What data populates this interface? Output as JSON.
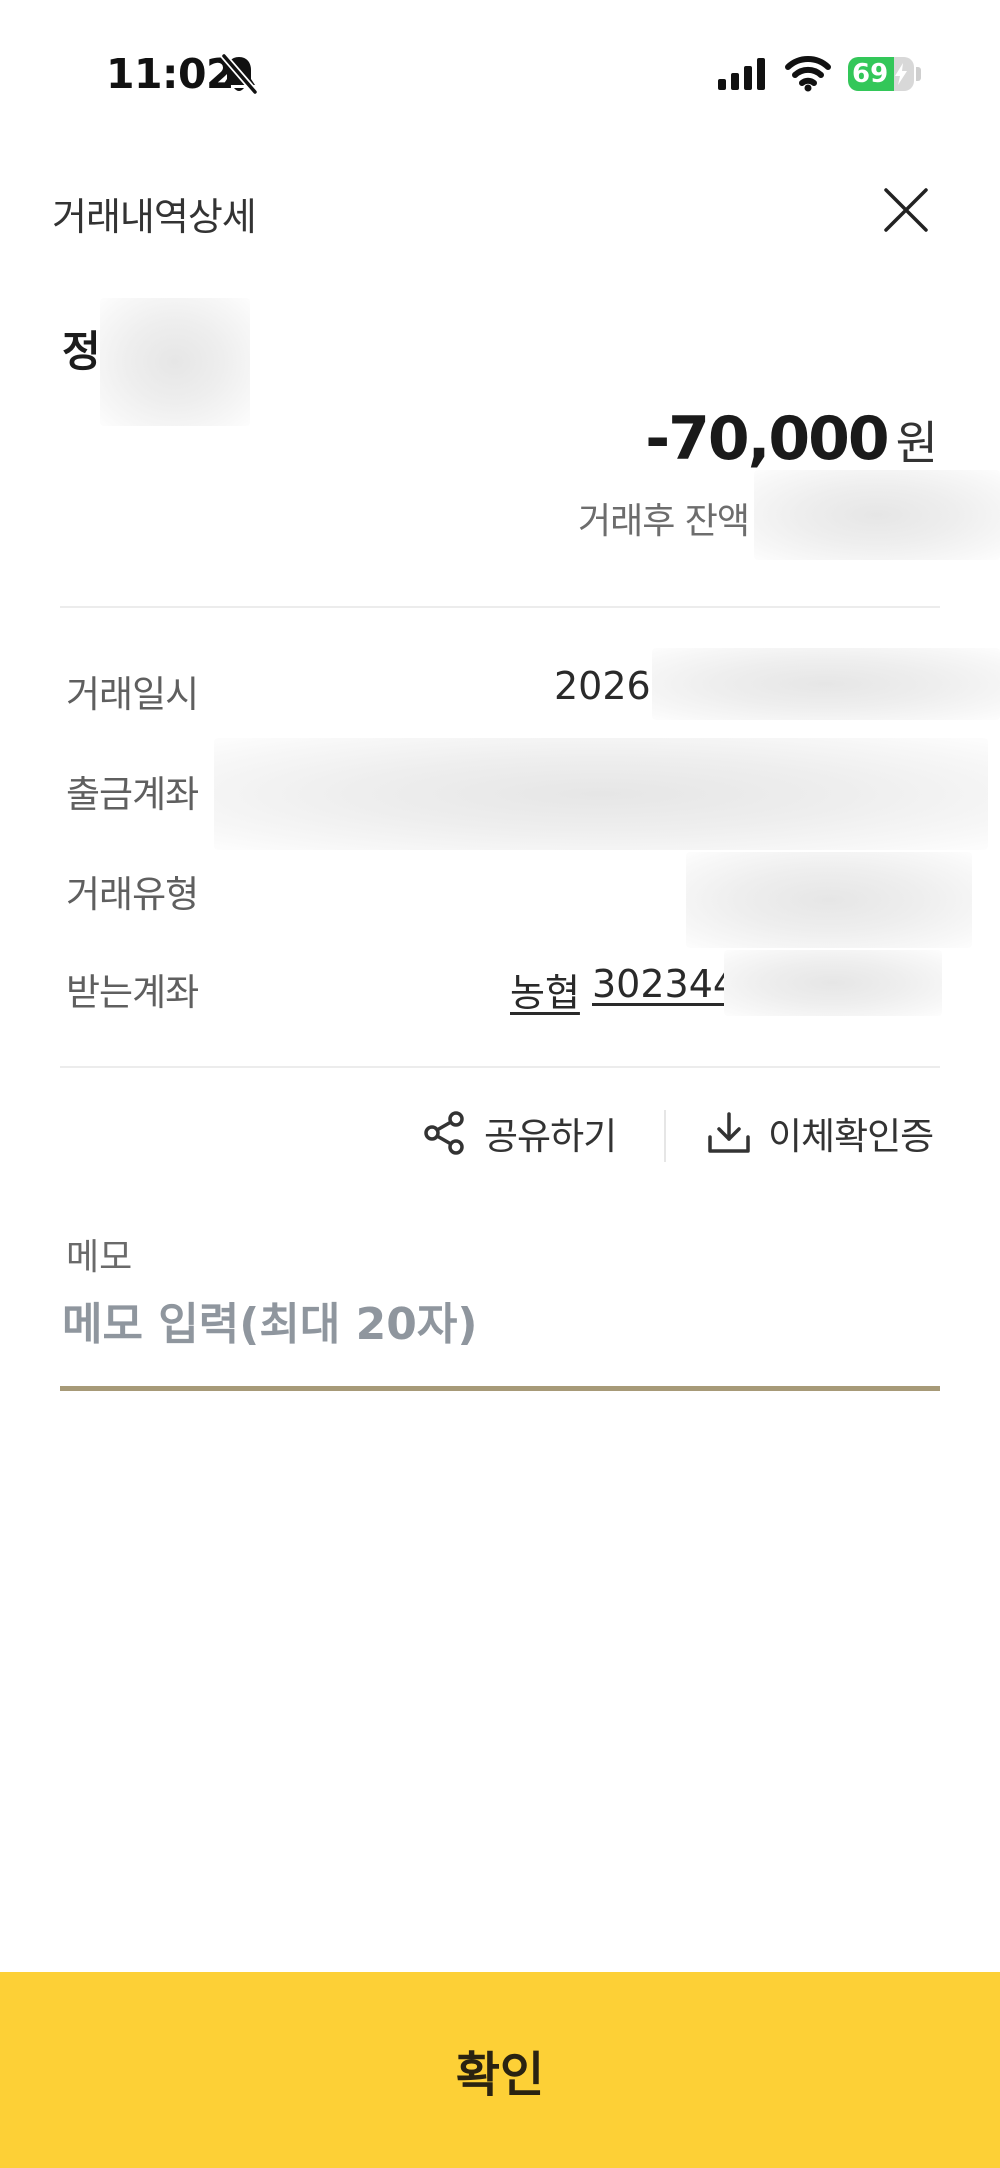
{
  "status_bar": {
    "time": "11:02",
    "battery_percent": "69",
    "battery_level": 0.69,
    "battery_color": "#33c759",
    "icons": [
      "bell-slash-icon",
      "cellular-signal-icon",
      "wifi-icon",
      "battery-icon"
    ]
  },
  "header": {
    "title": "거래내역상세",
    "close_icon": "close-icon"
  },
  "summary": {
    "recipient_name": "정",
    "amount": "-70,000",
    "amount_unit": "원",
    "balance_label": "거래후 잔액"
  },
  "details": {
    "datetime_label": "거래일시",
    "datetime_value": "2026",
    "from_account_label": "출금계좌",
    "type_label": "거래유형",
    "to_account_label": "받는계좌",
    "to_bank": "농협",
    "to_account": "302344"
  },
  "actions": {
    "share_label": "공유하기",
    "share_icon": "share-icon",
    "certificate_label": "이체확인증",
    "certificate_icon": "download-icon"
  },
  "memo": {
    "label": "메모",
    "placeholder": "메모 입력(최대 20자)",
    "value": ""
  },
  "footer": {
    "confirm_label": "확인",
    "button_color": "#fdd036"
  }
}
